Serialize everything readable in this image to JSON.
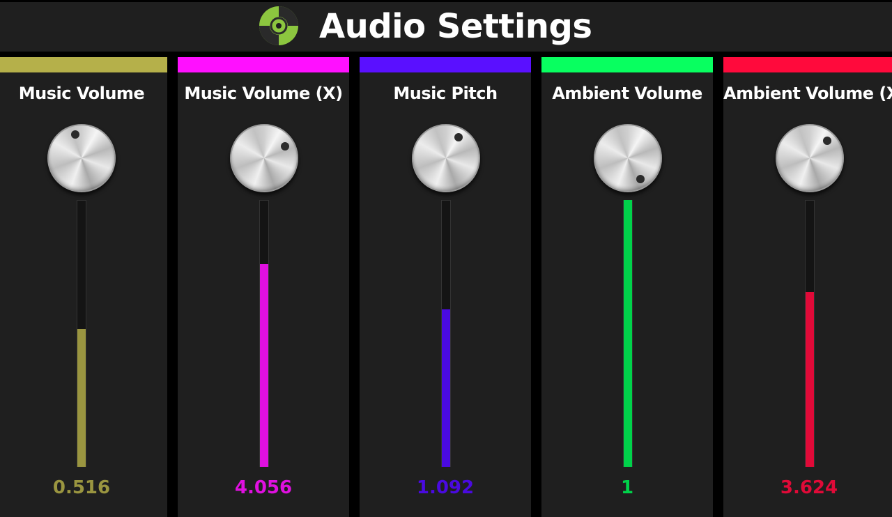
{
  "header": {
    "title": "Audio Settings",
    "logo_icon": "music-disc-icon",
    "logo_color": "#8cc63f"
  },
  "channels": [
    {
      "label": "Music Volume",
      "value": "0.516",
      "level": 0.516,
      "color": "#b5b04a",
      "fill_color": "#9a9540",
      "knob_angle": -15
    },
    {
      "label": "Music Volume (X)",
      "value": "4.056",
      "level": 0.76,
      "color": "#ff10ff",
      "fill_color": "#e010e0",
      "knob_angle": 60
    },
    {
      "label": "Music Pitch",
      "value": "1.092",
      "level": 0.59,
      "color": "#5a10ff",
      "fill_color": "#4a0ae0",
      "knob_angle": 30
    },
    {
      "label": "Ambient Volume",
      "value": "1",
      "level": 1.0,
      "color": "#08ff60",
      "fill_color": "#00d24a",
      "knob_angle": 150
    },
    {
      "label": "Ambient Volume (X)",
      "value": "3.624",
      "level": 0.655,
      "color": "#ff0a3c",
      "fill_color": "#e00a38",
      "knob_angle": 45
    }
  ]
}
